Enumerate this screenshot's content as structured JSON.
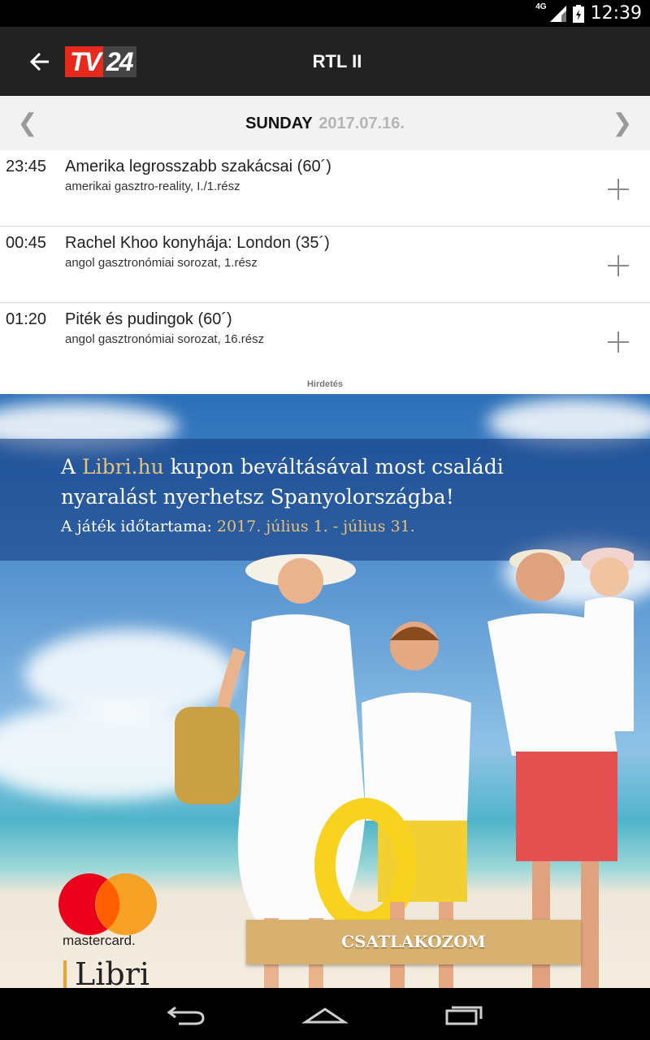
{
  "status_bar": {
    "network": "4G",
    "time": "12:39",
    "icons": [
      "signal-icon",
      "battery-icon"
    ]
  },
  "app_bar": {
    "back_icon": "arrow-left-icon",
    "logo_text_a": "TV",
    "logo_text_b": "24",
    "title": "RTL II"
  },
  "date_bar": {
    "prev": "❮",
    "next": "❯",
    "day": "SUNDAY",
    "date": "2017.07.16."
  },
  "programmes": [
    {
      "time": "23:45",
      "title": "Amerika legrosszabb szakácsai (60´)",
      "desc": "amerikai gasztro-reality, I./1.rész"
    },
    {
      "time": "00:45",
      "title": "Rachel Khoo konyhája: London (35´)",
      "desc": "angol gasztronómiai sorozat, 1.rész"
    },
    {
      "time": "01:20",
      "title": "Piték és pudingok (60´)",
      "desc": "angol gasztronómiai sorozat, 16.rész"
    }
  ],
  "ad": {
    "label": "Hirdetés",
    "line1_a": "A ",
    "line1_b": "Libri.hu",
    "line1_c": " kupon beváltásával  most családi",
    "line2": "nyaralást nyerhetsz Spanyolországba!",
    "line3_a": "A játék időtartama: ",
    "line3_b": "2017. július 1. - július 31.",
    "cta": "CSATLAKOZOM",
    "brand_1": "mastercard.",
    "brand_2": "Libri",
    "colors": {
      "mc_red": "#eb001b",
      "mc_orange": "#f79e1b",
      "cta_bg": "#d8b170"
    }
  },
  "nav_bar": {
    "back_icon": "nav-back-icon",
    "home_icon": "nav-home-icon",
    "recents_icon": "nav-recents-icon"
  },
  "colors": {
    "app_bar": "#222222",
    "logo_red": "#e8291c",
    "date_bar_bg": "#f2f2f2"
  }
}
